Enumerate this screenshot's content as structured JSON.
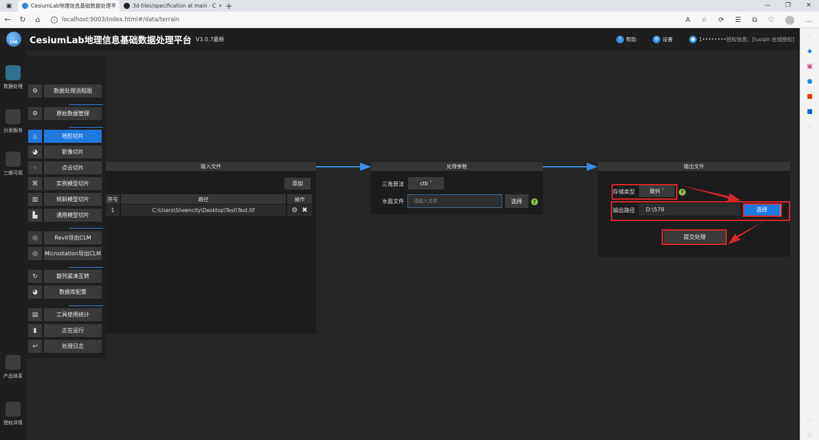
{
  "browser": {
    "tabs": [
      {
        "title": "CesiumLab地理信息基础数据处理平",
        "active": true,
        "favicon_color": "#2a86d9"
      },
      {
        "title": "3d-tiles/specification at main · C",
        "active": false,
        "favicon_color": "#222222"
      }
    ],
    "url": "localhost:9003/index.html#/data/terrain"
  },
  "header": {
    "logo_text": "CAB",
    "title": "CesiumLab地理信息基础数据处理平台",
    "version": "V3.0.7最新",
    "help_label": "帮助",
    "settings_label": "设置",
    "user_text": "1••••••••授权信息：[luoqin 在线授权]"
  },
  "rail": [
    {
      "label": "数据处理",
      "active": true
    },
    {
      "label": "分发服务",
      "active": false
    },
    {
      "label": "三维可视",
      "active": false
    },
    {
      "label": "产品体系",
      "active": false
    },
    {
      "label": "授权详情",
      "active": false
    }
  ],
  "menu": [
    {
      "label": "数据处理流程图",
      "icon": "gear-icon",
      "glyph": "⚙"
    },
    {
      "label": "原始数据管理",
      "icon": "gear-icon",
      "glyph": "⚙"
    },
    {
      "label": "地形切片",
      "icon": "terrain-icon",
      "glyph": "◬",
      "active": true
    },
    {
      "label": "影像切片",
      "icon": "globe-icon",
      "glyph": "◕"
    },
    {
      "label": "点云切片",
      "icon": "pointcloud-icon",
      "glyph": "⁘"
    },
    {
      "label": "实例模型切片",
      "icon": "instance-icon",
      "glyph": "⌘"
    },
    {
      "label": "倾斜模型切片",
      "icon": "building-icon",
      "glyph": "▥"
    },
    {
      "label": "通用模型切片",
      "icon": "model-icon",
      "glyph": "▙"
    },
    {
      "label": "Revit导出CLM",
      "icon": "revit-icon",
      "glyph": "◎"
    },
    {
      "label": "Microstation导出CLM",
      "icon": "microstation-icon",
      "glyph": "◎"
    },
    {
      "label": "散列紧凑互转",
      "icon": "convert-icon",
      "glyph": "↻"
    },
    {
      "label": "数据库配置",
      "icon": "database-icon",
      "glyph": "◕"
    },
    {
      "label": "工具使用统计",
      "icon": "document-icon",
      "glyph": "▤"
    },
    {
      "label": "正在运行",
      "icon": "chart-icon",
      "glyph": "▮"
    },
    {
      "label": "处理日志",
      "icon": "return-icon",
      "glyph": "↩"
    }
  ],
  "input_panel": {
    "title": "输入文件",
    "add_label": "添加",
    "columns": [
      "序号",
      "路径",
      "操作"
    ],
    "rows": [
      {
        "index": "1",
        "path": "C:\\Users\\Sheencity\\Desktop\\Test\\Test.tif"
      }
    ]
  },
  "process_panel": {
    "title": "处理参数",
    "algo_label": "三角算法",
    "algo_value": "ctb",
    "water_label": "水面文件",
    "water_placeholder": "请输入文件",
    "select_label": "选择",
    "help_glyph": "?"
  },
  "output_panel": {
    "title": "输出文件",
    "storage_label": "存储类型",
    "storage_value": "散列",
    "path_label": "输出路径",
    "path_value": "D:\\578",
    "select_label": "选择",
    "submit_label": "提交处理",
    "help_glyph": "?"
  },
  "colors": {
    "accent": "#1f7ae0",
    "annotation": "#d9262c",
    "connector": "#3a8ee6"
  }
}
